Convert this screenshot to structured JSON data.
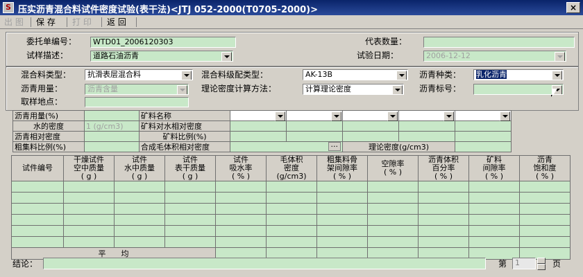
{
  "window": {
    "title": "压实沥青混合料试件密度试验(表干法)<JTJ 052-2000(T0705-2000)>",
    "close_symbol": "×"
  },
  "toolbar": {
    "items": [
      {
        "label": "出 图",
        "enabled": false
      },
      {
        "label": "保 存",
        "enabled": true
      },
      {
        "label": "打 印",
        "enabled": false
      },
      {
        "label": "返 回",
        "enabled": true
      }
    ]
  },
  "form": {
    "order_no_label": "委托单编号：",
    "order_no_value": "WTD01_2006120303",
    "rep_qty_label": "代表数量：",
    "rep_qty_value": "",
    "sample_desc_label": "试样描述：",
    "sample_desc_value": "道路石油沥青",
    "test_date_label": "试验日期：",
    "test_date_value": "2006-12-12",
    "mix_type_label": "混合料类型：",
    "mix_type_value": "抗滑表层混合料",
    "grading_label": "混合料级配类型：",
    "grading_value": "AK-13B",
    "asphalt_kind_label": "沥青种类：",
    "asphalt_kind_value": "乳化沥青",
    "asphalt_amount_label": "沥青用量：",
    "asphalt_amount_value": "沥青含量",
    "method_label": "理论密度计算方法：",
    "method_value": "计算理论密度",
    "asphalt_grade_label": "沥青标号：",
    "asphalt_grade_value": "",
    "location_label": "取样地点：",
    "location_value": ""
  },
  "mix_table": {
    "r1": "沥青用量(%)",
    "r2": "水的密度",
    "r2_value": "1 (g/cm3)",
    "r3": "沥青相对密度",
    "r4": "粗集料比例(%)",
    "m1": "矿料名称",
    "m2": "矿料对水相对密度",
    "m3": "矿料比例(%)",
    "m4": "合成毛体积相对密度",
    "ellipsis": "···",
    "theory_label": "理论密度(g/cm3)"
  },
  "grid": {
    "headers": [
      [
        "试件编号",
        ""
      ],
      [
        "干燥试件",
        "空中质量",
        "( g )"
      ],
      [
        "试件",
        "水中质量",
        "( g )"
      ],
      [
        "试件",
        "表干质量",
        "( g )"
      ],
      [
        "试件",
        "吸水率",
        "( % )"
      ],
      [
        "毛体积",
        "密度",
        "(g/cm3)"
      ],
      [
        "粗集料骨",
        "架间隙率",
        "( % )"
      ],
      [
        "空隙率",
        "( % )"
      ],
      [
        "沥青体积",
        "百分率",
        "( % )"
      ],
      [
        "矿料",
        "间隙率",
        "( % )"
      ],
      [
        "沥青",
        "饱和度",
        "( % )"
      ]
    ],
    "avg_label": "平　　均"
  },
  "footer": {
    "conclusion_label": "结论：",
    "conclusion_value": "",
    "page_prefix": "第",
    "page_value": "1",
    "page_suffix": "页"
  }
}
